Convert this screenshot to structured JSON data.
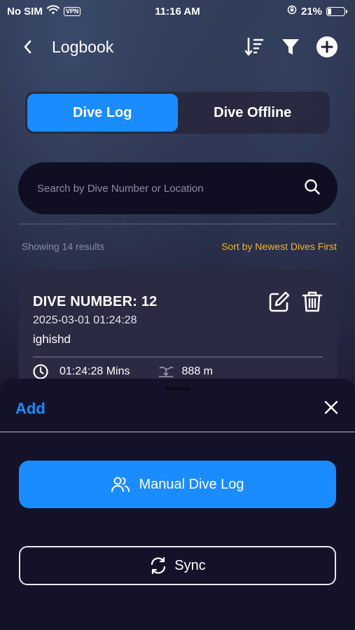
{
  "status_bar": {
    "carrier": "No SIM",
    "vpn": "VPN",
    "time": "11:16 AM",
    "battery": "21%"
  },
  "header": {
    "title": "Logbook"
  },
  "tabs": [
    {
      "label": "Dive Log",
      "active": true
    },
    {
      "label": "Dive Offline",
      "active": false
    }
  ],
  "search": {
    "placeholder": "Search by Dive Number or Location"
  },
  "results": {
    "count_text": "Showing 14 results",
    "sort_text": "Sort by Newest Dives First"
  },
  "dive_card": {
    "title": "DIVE NUMBER: 12",
    "datetime": "2025-03-01 01:24:28",
    "location": "ighishd",
    "duration": "01:24:28 Mins",
    "depth": "888 m"
  },
  "sheet": {
    "title": "Add",
    "manual_label": "Manual Dive Log",
    "sync_label": "Sync"
  },
  "colors": {
    "accent": "#1a8cff",
    "sort_link": "#f5b428",
    "background": "#17162b",
    "card": "#2a2a42"
  }
}
